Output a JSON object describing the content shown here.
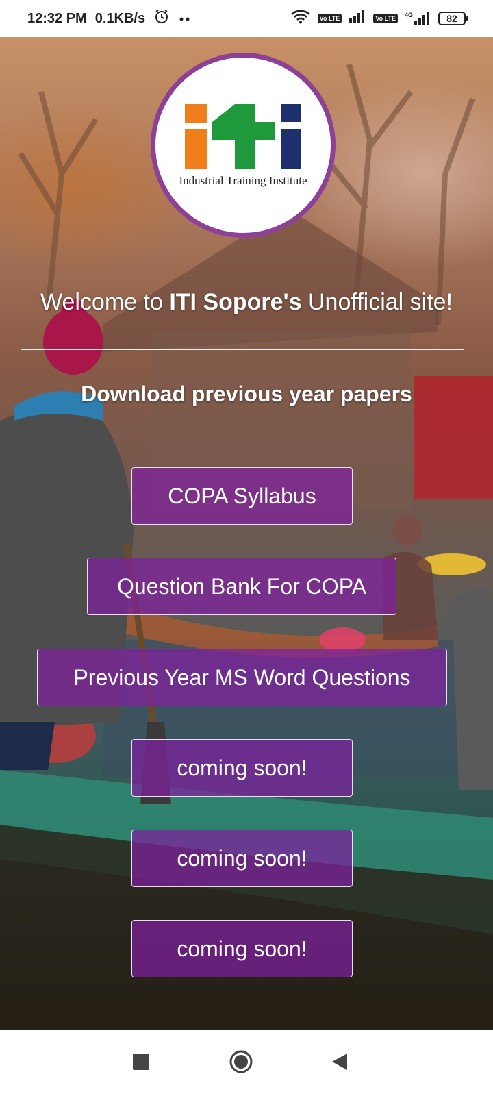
{
  "status_bar": {
    "time": "12:32 PM",
    "speed": "0.1KB/s",
    "battery": "82",
    "sim1_badge": "Vo LTE",
    "sim2_badge": "Vo LTE",
    "sim2_network": "4G",
    "icons": [
      "alarm-icon",
      "more-dots-icon",
      "wifi-icon",
      "signal-icon",
      "battery-icon"
    ]
  },
  "logo": {
    "letters": "iti",
    "caption": "Industrial Training Institute",
    "colors": {
      "i1": "#f07e1a",
      "t": "#1e9a3c",
      "i2": "#1e2f6e",
      "ring": "#8e3f96"
    }
  },
  "welcome": {
    "prefix": "Welcome to ",
    "bold": "ITI Sopore's",
    "suffix": " Unofficial site!"
  },
  "subtitle": "Download previous year papers",
  "buttons": [
    {
      "label": "COPA Syllabus"
    },
    {
      "label": "Question Bank For COPA"
    },
    {
      "label": "Previous Year MS Word Questions"
    },
    {
      "label": "coming soon!"
    },
    {
      "label": "coming soon!"
    },
    {
      "label": "coming soon!"
    }
  ],
  "nav": {
    "items": [
      "recents-square-icon",
      "home-circle-icon",
      "back-triangle-icon"
    ]
  },
  "theme": {
    "button_bg": "#8020a0",
    "accent": "#8e3f96"
  }
}
